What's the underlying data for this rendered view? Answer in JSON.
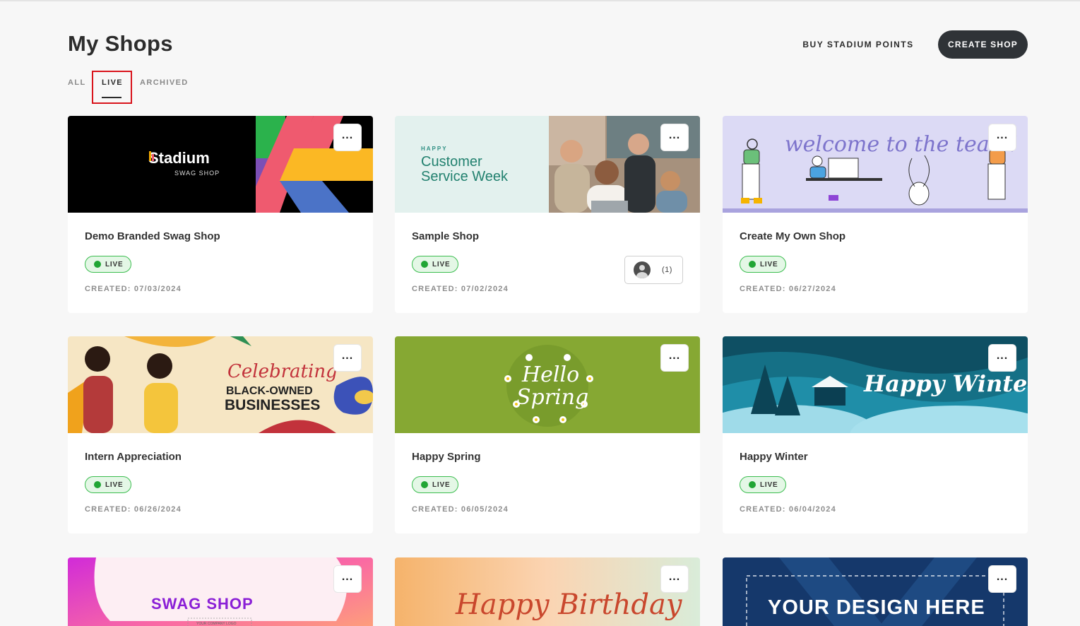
{
  "page": {
    "title": "My Shops"
  },
  "header": {
    "buy_points_label": "BUY STADIUM POINTS",
    "create_shop_label": "CREATE SHOP"
  },
  "tabs": [
    {
      "label": "ALL",
      "active": false
    },
    {
      "label": "LIVE",
      "active": true
    },
    {
      "label": "ARCHIVED",
      "active": false
    }
  ],
  "status_color": "#21a635",
  "highlight_color": "#d9141c",
  "cards": [
    {
      "title": "Demo Branded Swag Shop",
      "status": "LIVE",
      "created": "CREATED: 07/03/2024",
      "banner": {
        "brand": "Stadium",
        "sub": "SWAG SHOP"
      }
    },
    {
      "title": "Sample Shop",
      "status": "LIVE",
      "created": "CREATED: 07/02/2024",
      "members_count": "(1)",
      "banner": {
        "line1": "HAPPY",
        "line2": "Customer",
        "line3": "Service Week"
      }
    },
    {
      "title": "Create My Own Shop",
      "status": "LIVE",
      "created": "CREATED: 06/27/2024",
      "banner": {
        "text": "welcome to the team!"
      }
    },
    {
      "title": "Intern Appreciation",
      "status": "LIVE",
      "created": "CREATED: 06/26/2024",
      "banner": {
        "line1": "Celebrating",
        "line2": "BLACK-OWNED",
        "line3": "BUSINESSES"
      }
    },
    {
      "title": "Happy Spring",
      "status": "LIVE",
      "created": "CREATED: 06/05/2024",
      "banner": {
        "line1": "Hello",
        "line2": "Spring"
      }
    },
    {
      "title": "Happy Winter",
      "status": "LIVE",
      "created": "CREATED: 06/04/2024",
      "banner": {
        "text": "Happy Winter"
      }
    },
    {
      "banner": {
        "text": "SWAG SHOP",
        "sub": "YOUR COMPANY LOGO"
      }
    },
    {
      "banner": {
        "text": "Happy Birthday"
      }
    },
    {
      "banner": {
        "text": "YOUR DESIGN HERE"
      }
    }
  ]
}
